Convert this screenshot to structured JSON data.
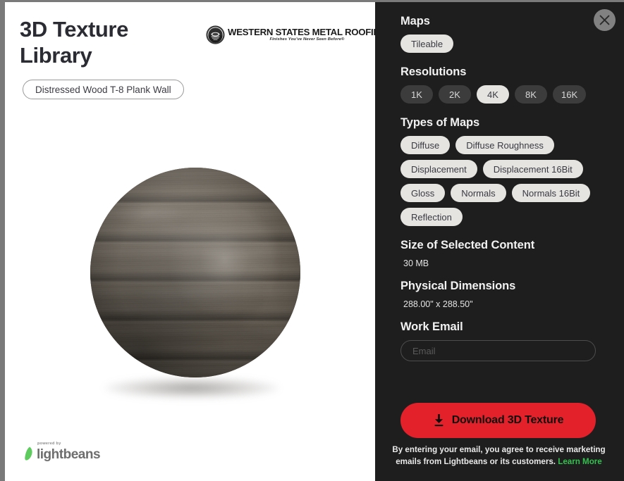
{
  "preview": {
    "title": "3D Texture\nLibrary",
    "title_line1": "3D Texture",
    "title_line2": "Library",
    "texture_name": "Distressed Wood T-8 Plank Wall",
    "brand_logo": {
      "name": "WESTERN STATES METAL ROOFING",
      "tagline": "Finishes You've Never Seen Before®",
      "icon": "wsmr-badge-icon"
    },
    "sphere": {
      "icon": "texture-preview-sphere",
      "base_color": "#6a6257"
    },
    "footer_logo": {
      "powered_by": "powered by",
      "name": "lightbeans",
      "icon": "bean-icon",
      "accent": "#5ecb5e"
    }
  },
  "panel": {
    "close_icon": "close-icon",
    "maps": {
      "heading": "Maps",
      "chips": [
        {
          "label": "Tileable",
          "selected": true
        }
      ]
    },
    "resolutions": {
      "heading": "Resolutions",
      "chips": [
        {
          "label": "1K",
          "selected": false
        },
        {
          "label": "2K",
          "selected": false
        },
        {
          "label": "4K",
          "selected": true
        },
        {
          "label": "8K",
          "selected": false
        },
        {
          "label": "16K",
          "selected": false
        }
      ]
    },
    "types_of_maps": {
      "heading": "Types of Maps",
      "chips": [
        {
          "label": "Diffuse",
          "selected": true
        },
        {
          "label": "Diffuse Roughness",
          "selected": true
        },
        {
          "label": "Displacement",
          "selected": true
        },
        {
          "label": "Displacement 16Bit",
          "selected": true
        },
        {
          "label": "Gloss",
          "selected": true
        },
        {
          "label": "Normals",
          "selected": true
        },
        {
          "label": "Normals 16Bit",
          "selected": true
        },
        {
          "label": "Reflection",
          "selected": true
        }
      ]
    },
    "size": {
      "heading": "Size of Selected Content",
      "value": "30 MB"
    },
    "dimensions": {
      "heading": "Physical Dimensions",
      "value": "288.00\" x 288.50\""
    },
    "work_email": {
      "heading": "Work Email",
      "placeholder": "Email",
      "value": ""
    },
    "download": {
      "label": "Download 3D Texture",
      "icon": "download-icon",
      "color": "#e2212a"
    },
    "disclaimer": {
      "text": "By entering your email, you agree to receive marketing emails from Lightbeans or its customers.",
      "link_label": "Learn More",
      "link_color": "#31c24d"
    }
  }
}
